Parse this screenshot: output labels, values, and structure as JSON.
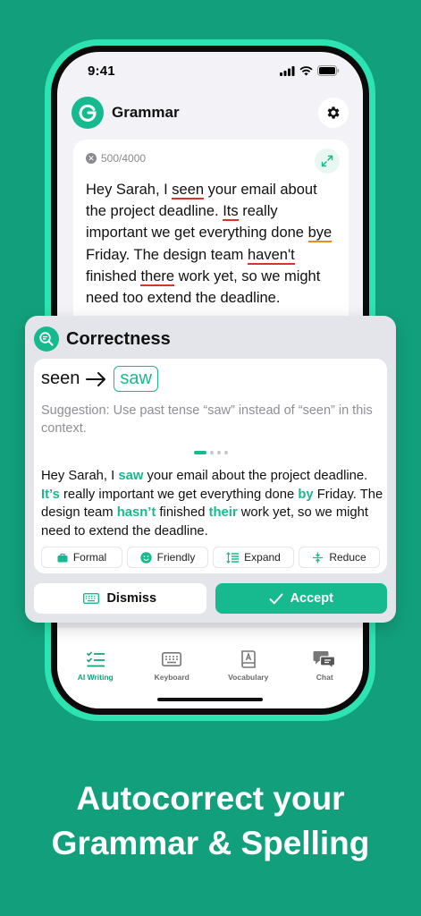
{
  "status_bar": {
    "time": "9:41"
  },
  "header": {
    "title": "Grammar"
  },
  "editor": {
    "counter": "500/4000",
    "segments": [
      {
        "t": "Hey Sarah, I ",
        "e": ""
      },
      {
        "t": "seen",
        "e": "red"
      },
      {
        "t": " your email about the project deadline. ",
        "e": ""
      },
      {
        "t": "Its",
        "e": "red"
      },
      {
        "t": " really important we get everything done ",
        "e": ""
      },
      {
        "t": "bye",
        "e": "orange"
      },
      {
        "t": " Friday. The design team ",
        "e": ""
      },
      {
        "t": "haven't",
        "e": "red"
      },
      {
        "t": " finished ",
        "e": ""
      },
      {
        "t": "there",
        "e": "red"
      },
      {
        "t": " work yet, so we might need too extend the deadline.",
        "e": ""
      }
    ]
  },
  "correction": {
    "title": "Correctness",
    "original_word": "seen",
    "suggested_word": "saw",
    "suggestion": "Suggestion: Use past tense “saw” instead of “seen” in this context.",
    "pages": 4,
    "active_page": 0,
    "corrected_segments": [
      {
        "t": "Hey Sarah, I ",
        "h": false
      },
      {
        "t": "saw",
        "h": true
      },
      {
        "t": " your email about the project deadline. ",
        "h": false
      },
      {
        "t": "It’s",
        "h": true
      },
      {
        "t": " really important we get everything done ",
        "h": false
      },
      {
        "t": "by",
        "h": true
      },
      {
        "t": " Friday. The design team ",
        "h": false
      },
      {
        "t": "hasn’t",
        "h": true
      },
      {
        "t": " finished ",
        "h": false
      },
      {
        "t": "their",
        "h": true
      },
      {
        "t": " work yet, so we might need to extend the deadline.",
        "h": false
      }
    ],
    "tones": {
      "formal": "Formal",
      "friendly": "Friendly",
      "expand": "Expand",
      "reduce": "Reduce"
    },
    "dismiss_label": "Dismiss",
    "accept_label": "Accept"
  },
  "tabs": [
    {
      "label": "AI Writing",
      "icon": "checklist-icon",
      "active": true
    },
    {
      "label": "Keyboard",
      "icon": "keyboard-icon",
      "active": false
    },
    {
      "label": "Vocabulary",
      "icon": "dictionary-icon",
      "active": false
    },
    {
      "label": "Chat",
      "icon": "chat-bubbles-icon",
      "active": false
    }
  ],
  "headline": {
    "line1": "Autocorrect your",
    "line2": "Grammar & Spelling"
  },
  "colors": {
    "brand": "#12a07c",
    "accent": "#17b98e",
    "frame": "#2de3b1",
    "error_red": "#e0302a",
    "error_orange": "#f08a1b"
  }
}
